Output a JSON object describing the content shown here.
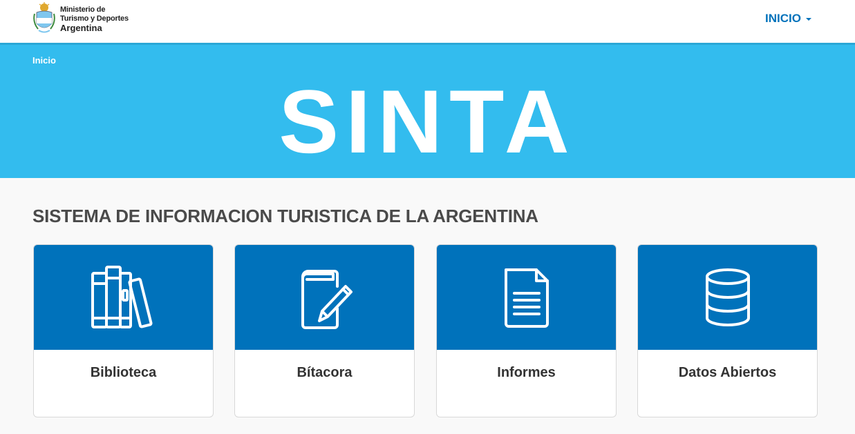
{
  "header": {
    "logo": {
      "line1": "Ministerio de",
      "line2": "Turismo y Deportes",
      "line3": "Argentina",
      "icon": "argentina-coat-of-arms"
    },
    "nav": {
      "label": "INICIO",
      "icon": "caret-down"
    }
  },
  "hero": {
    "breadcrumb": "Inicio",
    "title": "SINTA",
    "background": "#33bcee"
  },
  "main": {
    "heading": "SISTEMA DE INFORMACION TURISTICA DE LA ARGENTINA",
    "cards": [
      {
        "label": "Biblioteca",
        "icon": "books-icon"
      },
      {
        "label": "Bítacora",
        "icon": "notebook-pencil-icon"
      },
      {
        "label": "Informes",
        "icon": "document-icon"
      },
      {
        "label": "Datos Abiertos",
        "icon": "database-icon"
      }
    ]
  },
  "colors": {
    "accent": "#0072bb",
    "hero": "#33bcee",
    "card_text": "#333333"
  }
}
